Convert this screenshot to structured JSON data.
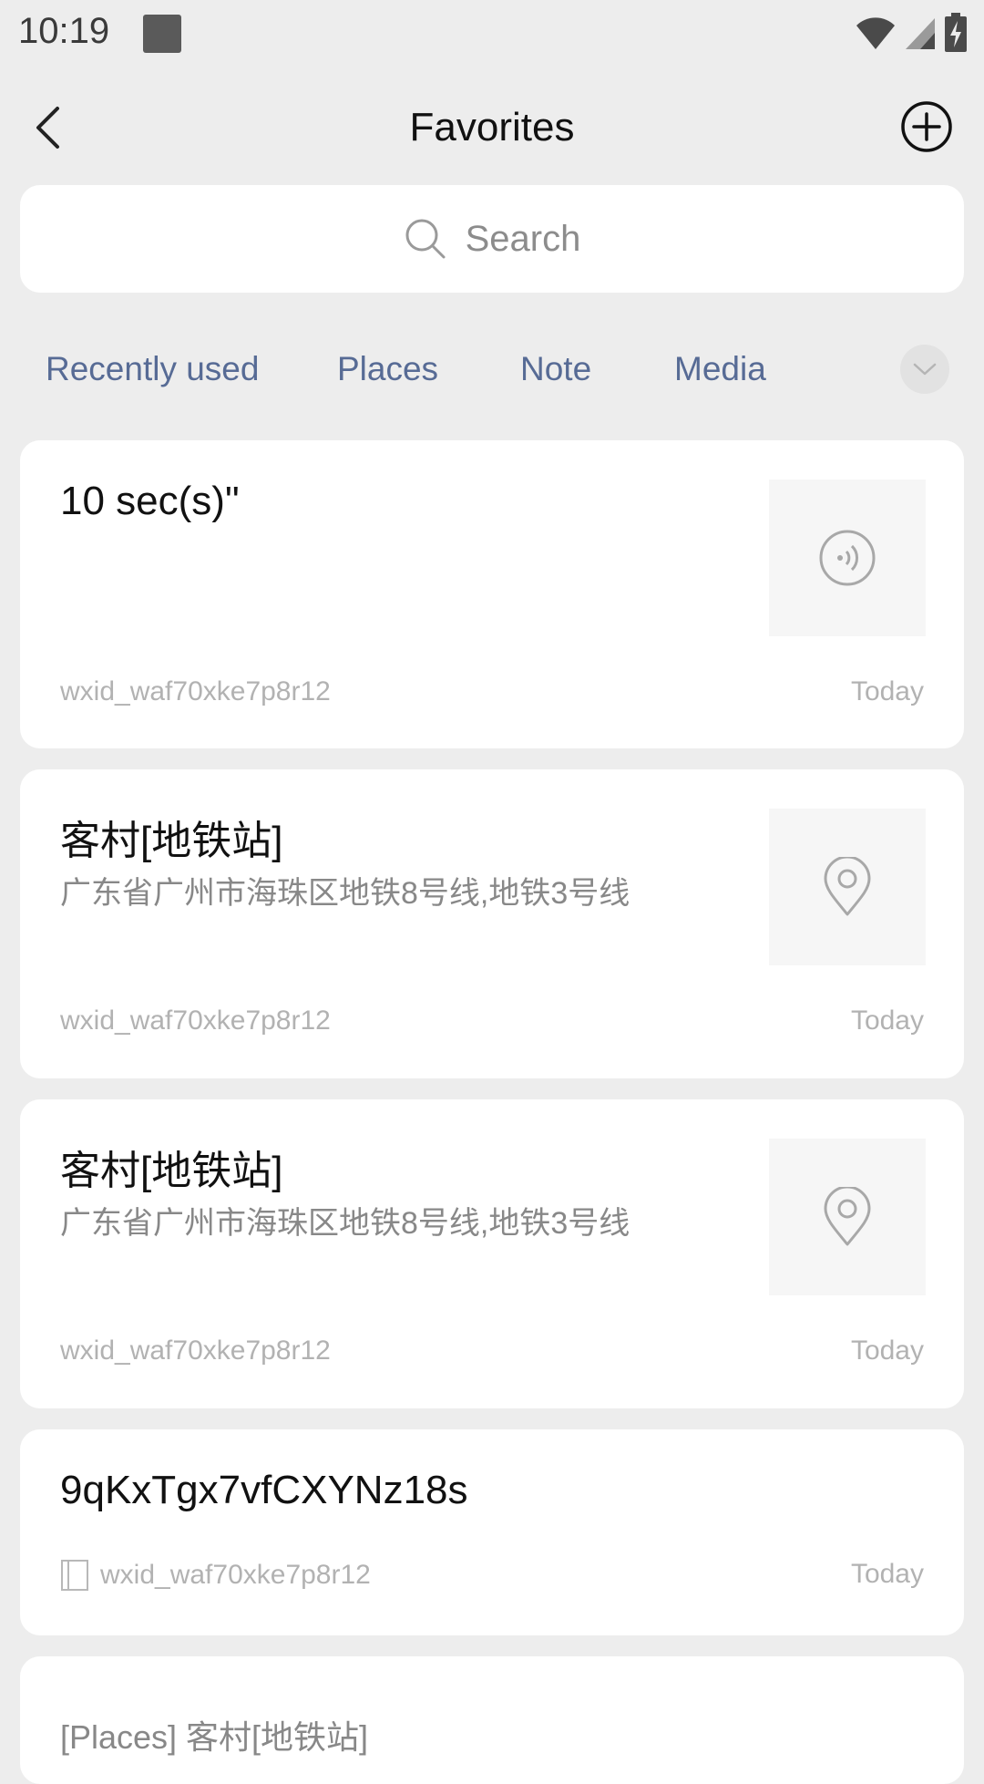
{
  "status_bar": {
    "time": "10:19",
    "icons": [
      "notification-square-icon",
      "wifi-icon",
      "signal-icon",
      "battery-charging-icon"
    ]
  },
  "header": {
    "title": "Favorites",
    "back_icon": "back-chevron-icon",
    "add_icon": "add-circle-icon"
  },
  "search": {
    "placeholder": "Search",
    "icon": "search-icon"
  },
  "tabs": [
    {
      "label": "Recently used"
    },
    {
      "label": "Places"
    },
    {
      "label": "Note"
    },
    {
      "label": "Media"
    }
  ],
  "items": [
    {
      "type": "voice",
      "title": "10 sec(s)\"",
      "source": "wxid_waf70xke7p8r12",
      "time": "Today",
      "thumb_icon": "voice-icon"
    },
    {
      "type": "place",
      "title": "客村[地铁站]",
      "subtitle": "广东省广州市海珠区地铁8号线,地铁3号线",
      "source": "wxid_waf70xke7p8r12",
      "time": "Today",
      "thumb_icon": "location-pin-icon"
    },
    {
      "type": "place",
      "title": "客村[地铁站]",
      "subtitle": "广东省广州市海珠区地铁8号线,地铁3号线",
      "source": "wxid_waf70xke7p8r12",
      "time": "Today",
      "thumb_icon": "location-pin-icon"
    },
    {
      "type": "note",
      "title": "9qKxTgx7vfCXYNz18s",
      "source": "wxid_waf70xke7p8r12",
      "time": "Today",
      "source_icon": "note-icon"
    },
    {
      "type": "chat-record",
      "snippet": "[Places] 客村[地铁站]"
    }
  ]
}
